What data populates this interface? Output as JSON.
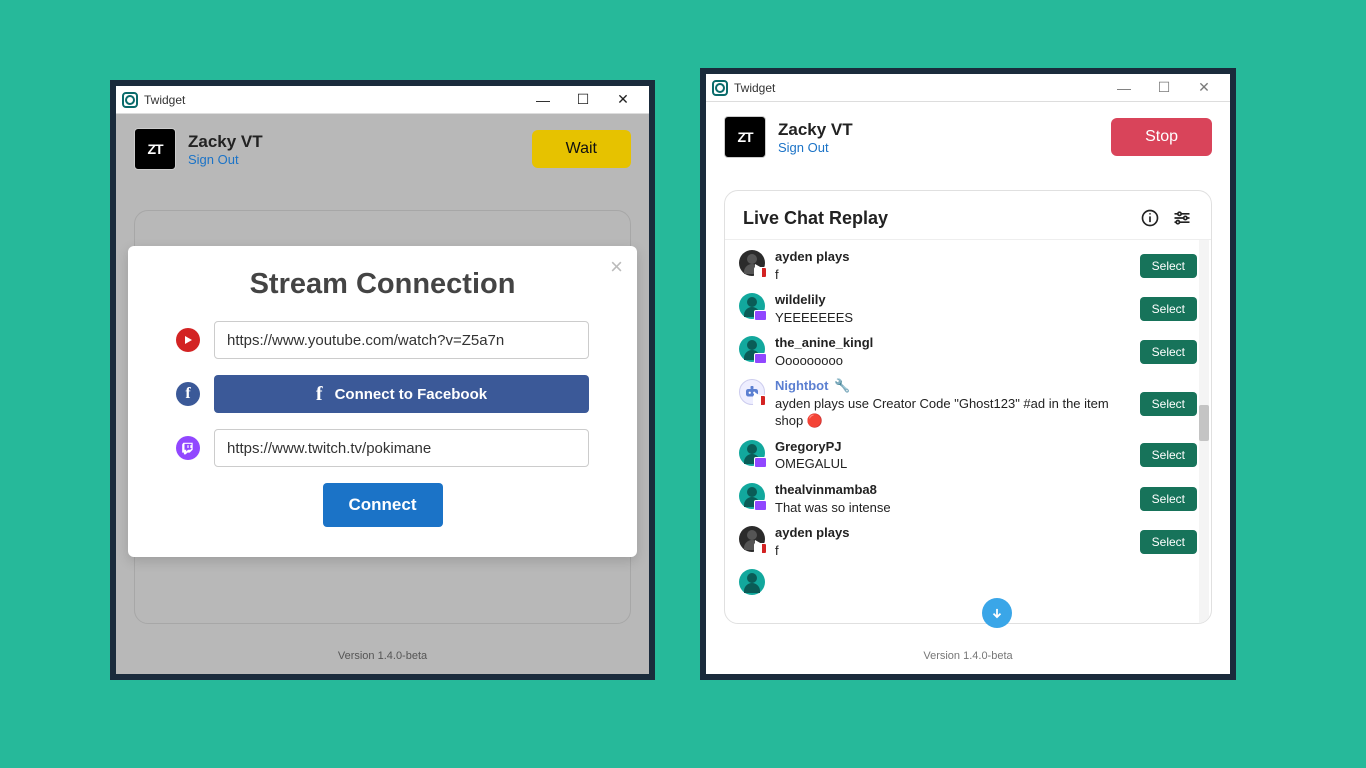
{
  "app_title": "Twidget",
  "version": "Version 1.4.0-beta",
  "user": {
    "name": "Zacky VT",
    "avatar_text": "ZT",
    "signout": "Sign Out"
  },
  "left": {
    "action_button": "Wait",
    "modal": {
      "title": "Stream Connection",
      "youtube_value": "https://www.youtube.com/watch?v=Z5a7n",
      "facebook_button": "Connect to Facebook",
      "twitch_value": "https://www.twitch.tv/pokimane",
      "connect": "Connect"
    }
  },
  "right": {
    "action_button": "Stop",
    "chat_title": "Live Chat Replay",
    "select_label": "Select",
    "messages": [
      {
        "user": "ayden plays",
        "msg": "f",
        "avatar": "dark",
        "badge": "yt",
        "bot": false
      },
      {
        "user": "wildelily",
        "msg": "YEEEEEEES",
        "avatar": "teal",
        "badge": "tw",
        "bot": false
      },
      {
        "user": "the_anine_kingl",
        "msg": "Ooooooooo",
        "avatar": "teal",
        "badge": "tw",
        "bot": false
      },
      {
        "user": "Nightbot",
        "msg": "ayden plays use Creator Code \"Ghost123\" #ad in the item shop 🔴",
        "avatar": "bot",
        "badge": "yt",
        "bot": true
      },
      {
        "user": "GregoryPJ",
        "msg": "OMEGALUL",
        "avatar": "teal",
        "badge": "tw",
        "bot": false
      },
      {
        "user": "thealvinmamba8",
        "msg": "That was so intense",
        "avatar": "teal",
        "badge": "tw",
        "bot": false
      },
      {
        "user": "ayden plays",
        "msg": "f",
        "avatar": "dark",
        "badge": "yt",
        "bot": false
      }
    ]
  }
}
